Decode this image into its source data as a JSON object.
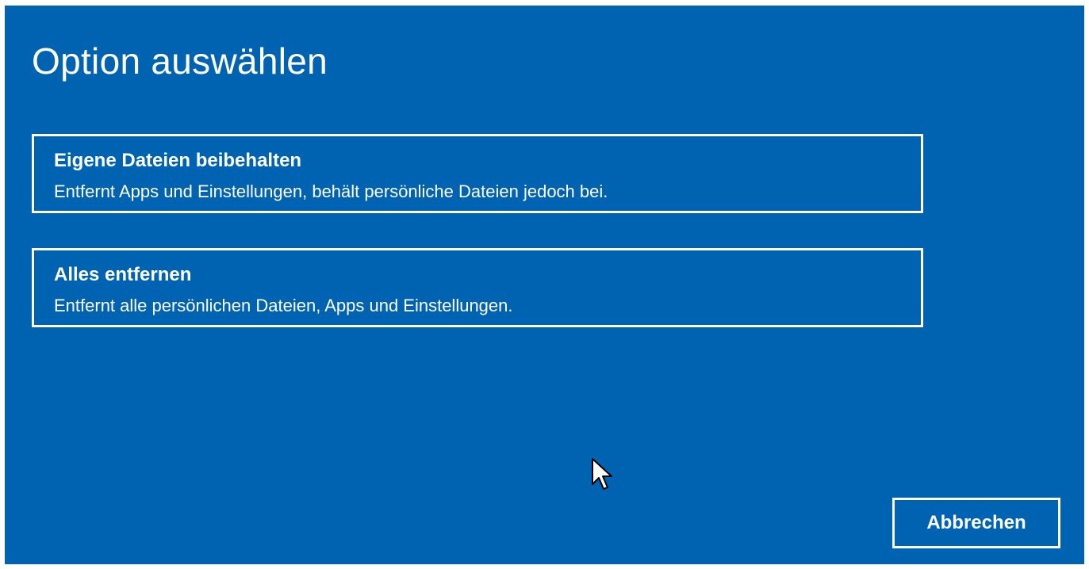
{
  "dialog": {
    "title": "Option auswählen",
    "background_color": "#0063b1",
    "text_color": "#ffffff"
  },
  "options": [
    {
      "title": "Eigene Dateien beibehalten",
      "description": "Entfernt Apps und Einstellungen, behält persönliche Dateien jedoch bei."
    },
    {
      "title": "Alles entfernen",
      "description": "Entfernt alle persönlichen Dateien, Apps und Einstellungen."
    }
  ],
  "actions": {
    "cancel_label": "Abbrechen"
  },
  "icons": {
    "cursor": "mouse-pointer-icon"
  }
}
